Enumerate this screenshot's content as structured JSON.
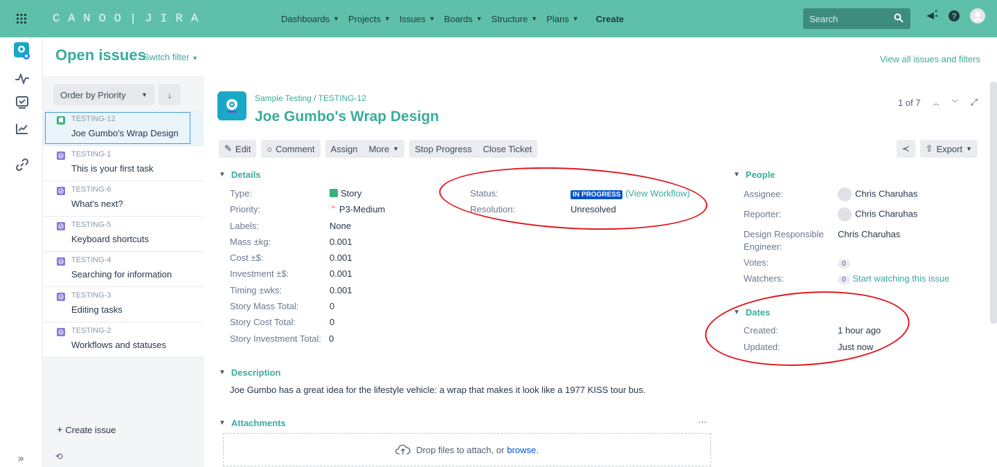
{
  "topnav": {
    "brand": "CANOO|JIRA",
    "menu": [
      {
        "label": "Dashboards"
      },
      {
        "label": "Projects"
      },
      {
        "label": "Issues"
      },
      {
        "label": "Boards"
      },
      {
        "label": "Structure"
      },
      {
        "label": "Plans"
      }
    ],
    "create": "Create",
    "search_placeholder": "Search"
  },
  "header": {
    "title": "Open issues",
    "switch_filter": "Switch filter",
    "view_all": "View all issues and filters"
  },
  "list": {
    "order_by": "Order by Priority",
    "items": [
      {
        "key": "TESTING-12",
        "summary": "Joe Gumbo's Wrap Design",
        "type": "story"
      },
      {
        "key": "TESTING-1",
        "summary": "This is your first task",
        "type": "task"
      },
      {
        "key": "TESTING-6",
        "summary": "What's next?",
        "type": "task"
      },
      {
        "key": "TESTING-5",
        "summary": "Keyboard shortcuts",
        "type": "task"
      },
      {
        "key": "TESTING-4",
        "summary": "Searching for information",
        "type": "task"
      },
      {
        "key": "TESTING-3",
        "summary": "Editing tasks",
        "type": "task"
      },
      {
        "key": "TESTING-2",
        "summary": "Workflows and statuses",
        "type": "task"
      }
    ],
    "create_issue": "Create issue"
  },
  "issue": {
    "project": "Sample Testing",
    "key": "TESTING-12",
    "title": "Joe Gumbo's Wrap Design",
    "pager": "1 of 7",
    "toolbar": {
      "edit": "Edit",
      "comment": "Comment",
      "assign": "Assign",
      "more": "More",
      "stop_progress": "Stop Progress",
      "close_ticket": "Close Ticket",
      "export": "Export"
    },
    "details": {
      "heading": "Details",
      "fields": [
        {
          "label": "Type:",
          "value": "Story"
        },
        {
          "label": "Priority:",
          "value": "P3-Medium"
        },
        {
          "label": "Labels:",
          "value": "None"
        },
        {
          "label": "Mass ±kg:",
          "value": "0.001"
        },
        {
          "label": "Cost ±$:",
          "value": "0.001"
        },
        {
          "label": "Investment ±$:",
          "value": "0.001"
        },
        {
          "label": "Timing ±wks:",
          "value": "0.001"
        },
        {
          "label": "Story Mass Total:",
          "value": "0"
        },
        {
          "label": "Story Cost Total:",
          "value": "0"
        },
        {
          "label": "Story Investment Total:",
          "value": "0"
        }
      ],
      "status_label": "Status:",
      "status": "IN PROGRESS",
      "view_workflow": "(View Workflow)",
      "resolution_label": "Resolution:",
      "resolution": "Unresolved"
    },
    "people": {
      "heading": "People",
      "assignee_label": "Assignee:",
      "assignee": "Chris Charuhas",
      "reporter_label": "Reporter:",
      "reporter": "Chris Charuhas",
      "dre_label_1": "Design Responsible",
      "dre_label_2": "Engineer:",
      "dre": "Chris Charuhas",
      "votes_label": "Votes:",
      "votes": "0",
      "watchers_label": "Watchers:",
      "watchers": "0",
      "start_watching": "Start watching this issue"
    },
    "dates": {
      "heading": "Dates",
      "created_label": "Created:",
      "created": "1 hour ago",
      "updated_label": "Updated:",
      "updated": "Just now"
    },
    "description": {
      "heading": "Description",
      "text": "Joe Gumbo has a great idea for the lifestyle vehicle: a wrap that makes it look like a 1977 KISS tour bus."
    },
    "attachments": {
      "heading": "Attachments",
      "drop_text": "Drop files to attach, or",
      "browse": "browse."
    }
  },
  "colors": {
    "nav": "#5fc0aa",
    "accent": "#3aab9a",
    "annotation": "#e0161d",
    "lozenge": "#0052cc"
  }
}
